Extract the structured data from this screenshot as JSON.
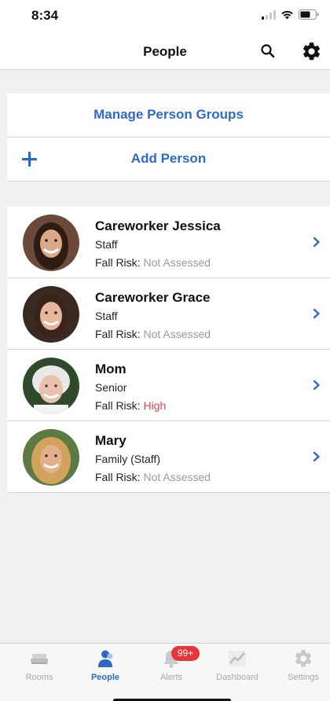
{
  "status_bar": {
    "time": "8:34"
  },
  "nav": {
    "title": "People",
    "search_icon": "search-icon",
    "settings_icon": "gear-icon"
  },
  "actions": {
    "manage_groups": "Manage Person Groups",
    "add_person": "Add Person"
  },
  "people": [
    {
      "name": "Careworker Jessica",
      "role": "Staff",
      "risk_label": "Fall Risk:",
      "risk_value": "Not Assessed",
      "risk_level": "none",
      "avatar_bg": "#6b4a3a",
      "skin": "#d9a98a",
      "hair": "#2e1c14"
    },
    {
      "name": "Careworker Grace",
      "role": "Staff",
      "risk_label": "Fall Risk:",
      "risk_value": "Not Assessed",
      "risk_level": "none",
      "avatar_bg": "#3b2a22",
      "skin": "#e6b79c",
      "hair": "#3a2318"
    },
    {
      "name": "Mom",
      "role": "Senior",
      "risk_label": "Fall Risk:",
      "risk_value": "High",
      "risk_level": "high",
      "avatar_bg": "#2f4a2a",
      "skin": "#e8c2ae",
      "hair": "#e9e9ea"
    },
    {
      "name": "Mary",
      "role": "Family (Staff)",
      "risk_label": "Fall Risk:",
      "risk_value": "Not Assessed",
      "risk_level": "none",
      "avatar_bg": "#5d7a45",
      "skin": "#e3b08e",
      "hair": "#d2a35c"
    }
  ],
  "tabs": [
    {
      "label": "Rooms",
      "icon": "bed-icon",
      "active": false
    },
    {
      "label": "People",
      "icon": "person-icon",
      "active": true
    },
    {
      "label": "Alerts",
      "icon": "bell-icon",
      "active": false,
      "badge": "99+"
    },
    {
      "label": "Dashboard",
      "icon": "chart-icon",
      "active": false
    },
    {
      "label": "Settings",
      "icon": "gear-icon",
      "active": false
    }
  ],
  "colors": {
    "accent": "#2b6bc7",
    "high_risk": "#d0474e",
    "badge": "#e8363c",
    "muted": "#9a9a9a"
  }
}
